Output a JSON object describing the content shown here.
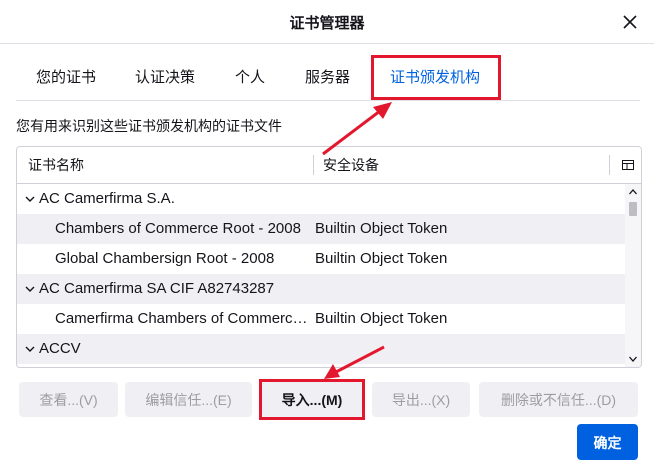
{
  "dialog": {
    "title": "证书管理器",
    "close_icon": "close-icon"
  },
  "tabs": [
    {
      "label": "您的证书",
      "selected": false
    },
    {
      "label": "认证决策",
      "selected": false
    },
    {
      "label": "个人",
      "selected": false
    },
    {
      "label": "服务器",
      "selected": false
    },
    {
      "label": "证书颁发机构",
      "selected": true
    }
  ],
  "description": "您有用来识别这些证书颁发机构的证书文件",
  "tree": {
    "columns": [
      "证书名称",
      "安全设备"
    ],
    "rows": [
      {
        "kind": "group",
        "name": "AC Camerfirma S.A.",
        "device": ""
      },
      {
        "kind": "cert",
        "name": "Chambers of Commerce Root - 2008",
        "device": "Builtin Object Token"
      },
      {
        "kind": "cert",
        "name": "Global Chambersign Root - 2008",
        "device": "Builtin Object Token"
      },
      {
        "kind": "group",
        "name": "AC Camerfirma SA CIF A82743287",
        "device": ""
      },
      {
        "kind": "cert",
        "name": "Camerfirma Chambers of Commerce Root",
        "device": "Builtin Object Token"
      },
      {
        "kind": "group",
        "name": "ACCV",
        "device": ""
      }
    ]
  },
  "buttons": {
    "view": "查看...(V)",
    "edit_trust": "编辑信任...(E)",
    "import": "导入...(M)",
    "export": "导出...(X)",
    "delete": "删除或不信任...(D)",
    "ok": "确定"
  },
  "colors": {
    "accent": "#0061e0",
    "annotation": "#e3182e"
  }
}
